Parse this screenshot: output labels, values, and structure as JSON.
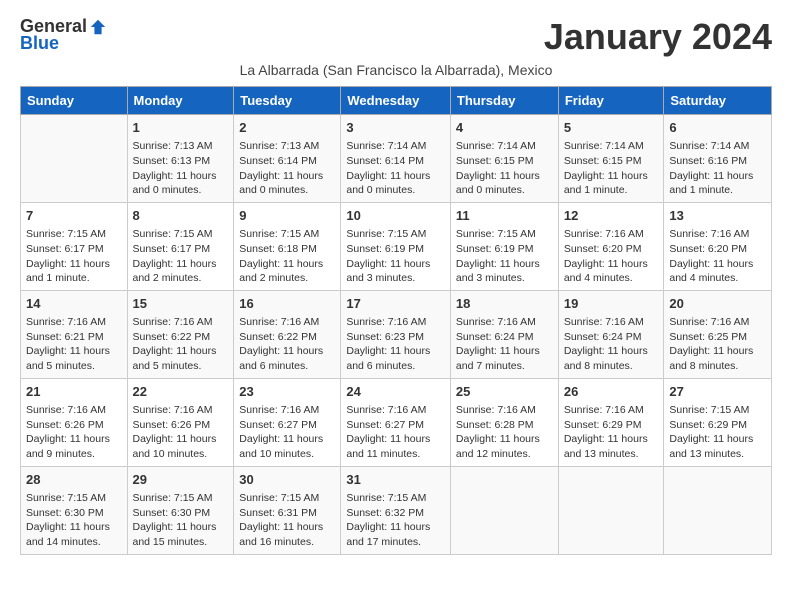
{
  "logo": {
    "general": "General",
    "blue": "Blue"
  },
  "title": "January 2024",
  "subtitle": "La Albarrada (San Francisco la Albarrada), Mexico",
  "days_of_week": [
    "Sunday",
    "Monday",
    "Tuesday",
    "Wednesday",
    "Thursday",
    "Friday",
    "Saturday"
  ],
  "weeks": [
    [
      {
        "day": "",
        "info": ""
      },
      {
        "day": "1",
        "info": "Sunrise: 7:13 AM\nSunset: 6:13 PM\nDaylight: 11 hours and 0 minutes."
      },
      {
        "day": "2",
        "info": "Sunrise: 7:13 AM\nSunset: 6:14 PM\nDaylight: 11 hours and 0 minutes."
      },
      {
        "day": "3",
        "info": "Sunrise: 7:14 AM\nSunset: 6:14 PM\nDaylight: 11 hours and 0 minutes."
      },
      {
        "day": "4",
        "info": "Sunrise: 7:14 AM\nSunset: 6:15 PM\nDaylight: 11 hours and 0 minutes."
      },
      {
        "day": "5",
        "info": "Sunrise: 7:14 AM\nSunset: 6:15 PM\nDaylight: 11 hours and 1 minute."
      },
      {
        "day": "6",
        "info": "Sunrise: 7:14 AM\nSunset: 6:16 PM\nDaylight: 11 hours and 1 minute."
      }
    ],
    [
      {
        "day": "7",
        "info": "Sunrise: 7:15 AM\nSunset: 6:17 PM\nDaylight: 11 hours and 1 minute."
      },
      {
        "day": "8",
        "info": "Sunrise: 7:15 AM\nSunset: 6:17 PM\nDaylight: 11 hours and 2 minutes."
      },
      {
        "day": "9",
        "info": "Sunrise: 7:15 AM\nSunset: 6:18 PM\nDaylight: 11 hours and 2 minutes."
      },
      {
        "day": "10",
        "info": "Sunrise: 7:15 AM\nSunset: 6:19 PM\nDaylight: 11 hours and 3 minutes."
      },
      {
        "day": "11",
        "info": "Sunrise: 7:15 AM\nSunset: 6:19 PM\nDaylight: 11 hours and 3 minutes."
      },
      {
        "day": "12",
        "info": "Sunrise: 7:16 AM\nSunset: 6:20 PM\nDaylight: 11 hours and 4 minutes."
      },
      {
        "day": "13",
        "info": "Sunrise: 7:16 AM\nSunset: 6:20 PM\nDaylight: 11 hours and 4 minutes."
      }
    ],
    [
      {
        "day": "14",
        "info": "Sunrise: 7:16 AM\nSunset: 6:21 PM\nDaylight: 11 hours and 5 minutes."
      },
      {
        "day": "15",
        "info": "Sunrise: 7:16 AM\nSunset: 6:22 PM\nDaylight: 11 hours and 5 minutes."
      },
      {
        "day": "16",
        "info": "Sunrise: 7:16 AM\nSunset: 6:22 PM\nDaylight: 11 hours and 6 minutes."
      },
      {
        "day": "17",
        "info": "Sunrise: 7:16 AM\nSunset: 6:23 PM\nDaylight: 11 hours and 6 minutes."
      },
      {
        "day": "18",
        "info": "Sunrise: 7:16 AM\nSunset: 6:24 PM\nDaylight: 11 hours and 7 minutes."
      },
      {
        "day": "19",
        "info": "Sunrise: 7:16 AM\nSunset: 6:24 PM\nDaylight: 11 hours and 8 minutes."
      },
      {
        "day": "20",
        "info": "Sunrise: 7:16 AM\nSunset: 6:25 PM\nDaylight: 11 hours and 8 minutes."
      }
    ],
    [
      {
        "day": "21",
        "info": "Sunrise: 7:16 AM\nSunset: 6:26 PM\nDaylight: 11 hours and 9 minutes."
      },
      {
        "day": "22",
        "info": "Sunrise: 7:16 AM\nSunset: 6:26 PM\nDaylight: 11 hours and 10 minutes."
      },
      {
        "day": "23",
        "info": "Sunrise: 7:16 AM\nSunset: 6:27 PM\nDaylight: 11 hours and 10 minutes."
      },
      {
        "day": "24",
        "info": "Sunrise: 7:16 AM\nSunset: 6:27 PM\nDaylight: 11 hours and 11 minutes."
      },
      {
        "day": "25",
        "info": "Sunrise: 7:16 AM\nSunset: 6:28 PM\nDaylight: 11 hours and 12 minutes."
      },
      {
        "day": "26",
        "info": "Sunrise: 7:16 AM\nSunset: 6:29 PM\nDaylight: 11 hours and 13 minutes."
      },
      {
        "day": "27",
        "info": "Sunrise: 7:15 AM\nSunset: 6:29 PM\nDaylight: 11 hours and 13 minutes."
      }
    ],
    [
      {
        "day": "28",
        "info": "Sunrise: 7:15 AM\nSunset: 6:30 PM\nDaylight: 11 hours and 14 minutes."
      },
      {
        "day": "29",
        "info": "Sunrise: 7:15 AM\nSunset: 6:30 PM\nDaylight: 11 hours and 15 minutes."
      },
      {
        "day": "30",
        "info": "Sunrise: 7:15 AM\nSunset: 6:31 PM\nDaylight: 11 hours and 16 minutes."
      },
      {
        "day": "31",
        "info": "Sunrise: 7:15 AM\nSunset: 6:32 PM\nDaylight: 11 hours and 17 minutes."
      },
      {
        "day": "",
        "info": ""
      },
      {
        "day": "",
        "info": ""
      },
      {
        "day": "",
        "info": ""
      }
    ]
  ]
}
